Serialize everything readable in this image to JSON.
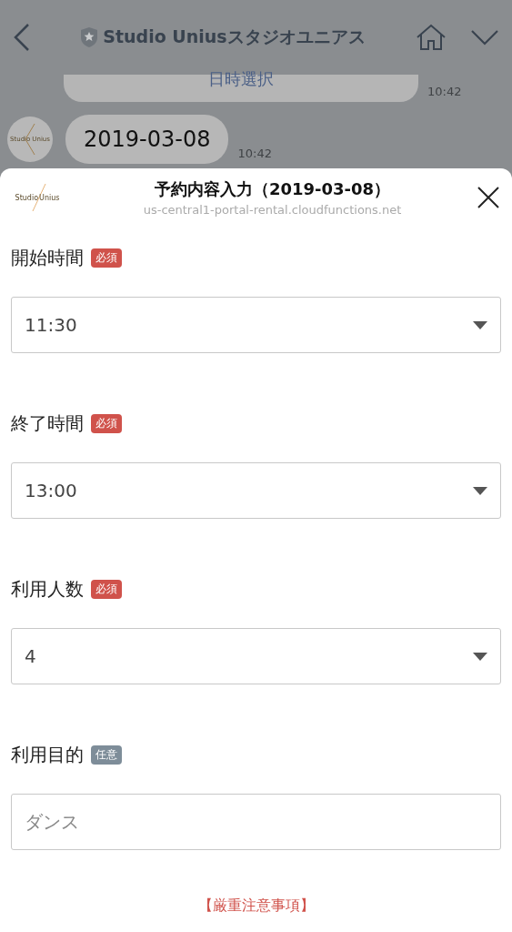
{
  "header": {
    "title": "Studio Uniusスタジオユニアス"
  },
  "chat": {
    "menu_bubble": {
      "text": "日時選択",
      "time": "10:42"
    },
    "avatar_text": [
      "Studio",
      "Unius"
    ],
    "message": {
      "text": "2019-03-08",
      "time": "10:42"
    }
  },
  "modal": {
    "title": "予約内容入力（2019-03-08）",
    "url": "us-central1-portal-rental.cloudfunctions.net",
    "logo_text": [
      "Studio",
      "Unius"
    ],
    "fields": [
      {
        "label": "開始時間",
        "badge": {
          "kind": "required",
          "text": "必須"
        },
        "kind": "select",
        "value": "11:30"
      },
      {
        "label": "終了時間",
        "badge": {
          "kind": "required",
          "text": "必須"
        },
        "kind": "select",
        "value": "13:00"
      },
      {
        "label": "利用人数",
        "badge": {
          "kind": "required",
          "text": "必須"
        },
        "kind": "select",
        "value": "4"
      },
      {
        "label": "利用目的",
        "badge": {
          "kind": "optional",
          "text": "任意"
        },
        "kind": "text",
        "placeholder": "ダンス"
      }
    ],
    "notice": "【厳重注意事項】"
  }
}
